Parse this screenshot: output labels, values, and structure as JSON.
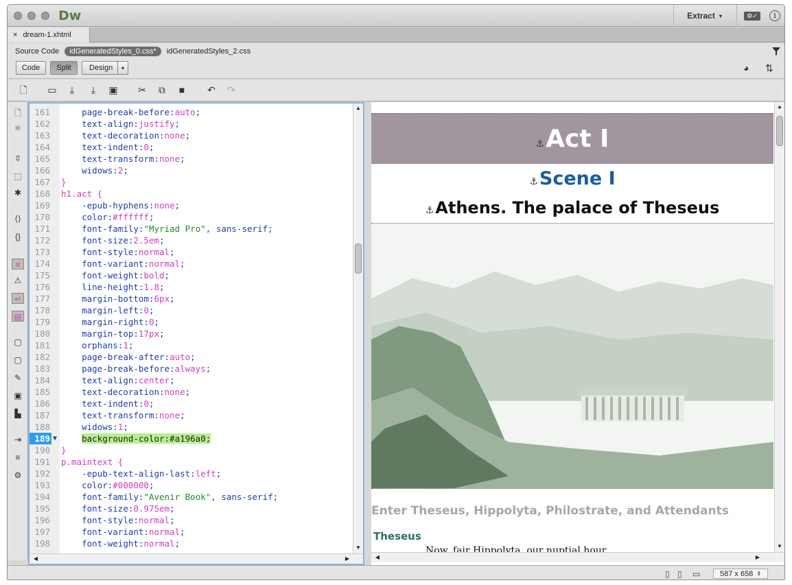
{
  "app": {
    "logo": "Dw",
    "extract": "Extract"
  },
  "doc_tab": {
    "close": "×",
    "name": "dream-1.xhtml"
  },
  "related": {
    "source": "Source Code",
    "files": [
      "idGeneratedStyles_0.css*",
      "idGeneratedStyles_2.css"
    ]
  },
  "views": {
    "code": "Code",
    "split": "Split",
    "design": "Design"
  },
  "code": {
    "lines": [
      {
        "n": "161",
        "t": [
          [
            "    ",
            ""
          ],
          [
            "page-break-before",
            "p"
          ],
          [
            ":",
            "p"
          ],
          [
            "auto",
            "v"
          ],
          [
            ";",
            "p"
          ]
        ]
      },
      {
        "n": "162",
        "t": [
          [
            "    ",
            ""
          ],
          [
            "text-align",
            "p"
          ],
          [
            ":",
            "p"
          ],
          [
            "justify",
            "v"
          ],
          [
            ";",
            "p"
          ]
        ]
      },
      {
        "n": "163",
        "t": [
          [
            "    ",
            ""
          ],
          [
            "text-decoration",
            "p"
          ],
          [
            ":",
            "p"
          ],
          [
            "none",
            "v"
          ],
          [
            ";",
            "p"
          ]
        ]
      },
      {
        "n": "164",
        "t": [
          [
            "    ",
            ""
          ],
          [
            "text-indent",
            "p"
          ],
          [
            ":",
            "p"
          ],
          [
            "0",
            "v"
          ],
          [
            ";",
            "p"
          ]
        ]
      },
      {
        "n": "165",
        "t": [
          [
            "    ",
            ""
          ],
          [
            "text-transform",
            "p"
          ],
          [
            ":",
            "p"
          ],
          [
            "none",
            "v"
          ],
          [
            ";",
            "p"
          ]
        ]
      },
      {
        "n": "166",
        "t": [
          [
            "    ",
            ""
          ],
          [
            "widows",
            "p"
          ],
          [
            ":",
            "p"
          ],
          [
            "2",
            "v"
          ],
          [
            ";",
            "p"
          ]
        ]
      },
      {
        "n": "167",
        "t": [
          [
            "}",
            "br"
          ]
        ]
      },
      {
        "n": "168",
        "t": [
          [
            "h1.act {",
            "sel"
          ]
        ]
      },
      {
        "n": "169",
        "t": [
          [
            "    ",
            ""
          ],
          [
            "-epub-hyphens",
            "p"
          ],
          [
            ":",
            "p"
          ],
          [
            "none",
            "v"
          ],
          [
            ";",
            "p"
          ]
        ]
      },
      {
        "n": "170",
        "t": [
          [
            "    ",
            ""
          ],
          [
            "color",
            "p"
          ],
          [
            ":",
            "p"
          ],
          [
            "#ffffff",
            "v"
          ],
          [
            ";",
            "p"
          ]
        ]
      },
      {
        "n": "171",
        "t": [
          [
            "    ",
            ""
          ],
          [
            "font-family",
            "p"
          ],
          [
            ":",
            "p"
          ],
          [
            "\"Myriad Pro\"",
            "s"
          ],
          [
            ", ",
            "p"
          ],
          [
            "sans-serif",
            "p"
          ],
          [
            ";",
            "p"
          ]
        ]
      },
      {
        "n": "172",
        "t": [
          [
            "    ",
            ""
          ],
          [
            "font-size",
            "p"
          ],
          [
            ":",
            "p"
          ],
          [
            "2.5em",
            "v"
          ],
          [
            ";",
            "p"
          ]
        ]
      },
      {
        "n": "173",
        "t": [
          [
            "    ",
            ""
          ],
          [
            "font-style",
            "p"
          ],
          [
            ":",
            "p"
          ],
          [
            "normal",
            "v"
          ],
          [
            ";",
            "p"
          ]
        ]
      },
      {
        "n": "174",
        "t": [
          [
            "    ",
            ""
          ],
          [
            "font-variant",
            "p"
          ],
          [
            ":",
            "p"
          ],
          [
            "normal",
            "v"
          ],
          [
            ";",
            "p"
          ]
        ]
      },
      {
        "n": "175",
        "t": [
          [
            "    ",
            ""
          ],
          [
            "font-weight",
            "p"
          ],
          [
            ":",
            "p"
          ],
          [
            "bold",
            "v"
          ],
          [
            ";",
            "p"
          ]
        ]
      },
      {
        "n": "176",
        "t": [
          [
            "    ",
            ""
          ],
          [
            "line-height",
            "p"
          ],
          [
            ":",
            "p"
          ],
          [
            "1.8",
            "v"
          ],
          [
            ";",
            "p"
          ]
        ]
      },
      {
        "n": "177",
        "t": [
          [
            "    ",
            ""
          ],
          [
            "margin-bottom",
            "p"
          ],
          [
            ":",
            "p"
          ],
          [
            "6px",
            "v"
          ],
          [
            ";",
            "p"
          ]
        ]
      },
      {
        "n": "178",
        "t": [
          [
            "    ",
            ""
          ],
          [
            "margin-left",
            "p"
          ],
          [
            ":",
            "p"
          ],
          [
            "0",
            "v"
          ],
          [
            ";",
            "p"
          ]
        ]
      },
      {
        "n": "179",
        "t": [
          [
            "    ",
            ""
          ],
          [
            "margin-right",
            "p"
          ],
          [
            ":",
            "p"
          ],
          [
            "0",
            "v"
          ],
          [
            ";",
            "p"
          ]
        ]
      },
      {
        "n": "180",
        "t": [
          [
            "    ",
            ""
          ],
          [
            "margin-top",
            "p"
          ],
          [
            ":",
            "p"
          ],
          [
            "17px",
            "v"
          ],
          [
            ";",
            "p"
          ]
        ]
      },
      {
        "n": "181",
        "t": [
          [
            "    ",
            ""
          ],
          [
            "orphans",
            "p"
          ],
          [
            ":",
            "p"
          ],
          [
            "1",
            "v"
          ],
          [
            ";",
            "p"
          ]
        ]
      },
      {
        "n": "182",
        "t": [
          [
            "    ",
            ""
          ],
          [
            "page-break-after",
            "p"
          ],
          [
            ":",
            "p"
          ],
          [
            "auto",
            "v"
          ],
          [
            ";",
            "p"
          ]
        ]
      },
      {
        "n": "183",
        "t": [
          [
            "    ",
            ""
          ],
          [
            "page-break-before",
            "p"
          ],
          [
            ":",
            "p"
          ],
          [
            "always",
            "v"
          ],
          [
            ";",
            "p"
          ]
        ]
      },
      {
        "n": "184",
        "t": [
          [
            "    ",
            ""
          ],
          [
            "text-align",
            "p"
          ],
          [
            ":",
            "p"
          ],
          [
            "center",
            "v"
          ],
          [
            ";",
            "p"
          ]
        ]
      },
      {
        "n": "185",
        "t": [
          [
            "    ",
            ""
          ],
          [
            "text-decoration",
            "p"
          ],
          [
            ":",
            "p"
          ],
          [
            "none",
            "v"
          ],
          [
            ";",
            "p"
          ]
        ]
      },
      {
        "n": "186",
        "t": [
          [
            "    ",
            ""
          ],
          [
            "text-indent",
            "p"
          ],
          [
            ":",
            "p"
          ],
          [
            "0",
            "v"
          ],
          [
            ";",
            "p"
          ]
        ]
      },
      {
        "n": "187",
        "t": [
          [
            "    ",
            ""
          ],
          [
            "text-transform",
            "p"
          ],
          [
            ":",
            "p"
          ],
          [
            "none",
            "v"
          ],
          [
            ";",
            "p"
          ]
        ]
      },
      {
        "n": "188",
        "t": [
          [
            "    ",
            ""
          ],
          [
            "widows",
            "p"
          ],
          [
            ":",
            "p"
          ],
          [
            "1",
            "v"
          ],
          [
            ";",
            "p"
          ]
        ]
      },
      {
        "n": "189",
        "cur": true,
        "t": [
          [
            "    ",
            ""
          ],
          [
            "background-color:#a196a0;",
            "hl"
          ]
        ]
      },
      {
        "n": "190",
        "t": [
          [
            "}",
            "br"
          ]
        ]
      },
      {
        "n": "191",
        "t": [
          [
            "p.maintext {",
            "sel"
          ]
        ]
      },
      {
        "n": "192",
        "t": [
          [
            "    ",
            ""
          ],
          [
            "-epub-text-align-last",
            "p"
          ],
          [
            ":",
            "p"
          ],
          [
            "left",
            "v"
          ],
          [
            ";",
            "p"
          ]
        ]
      },
      {
        "n": "193",
        "t": [
          [
            "    ",
            ""
          ],
          [
            "color",
            "p"
          ],
          [
            ":",
            "p"
          ],
          [
            "#000000",
            "v"
          ],
          [
            ";",
            "p"
          ]
        ]
      },
      {
        "n": "194",
        "t": [
          [
            "    ",
            ""
          ],
          [
            "font-family",
            "p"
          ],
          [
            ":",
            "p"
          ],
          [
            "\"Avenir Book\"",
            "s"
          ],
          [
            ", ",
            "p"
          ],
          [
            "sans-serif",
            "p"
          ],
          [
            ";",
            "p"
          ]
        ]
      },
      {
        "n": "195",
        "t": [
          [
            "    ",
            ""
          ],
          [
            "font-size",
            "p"
          ],
          [
            ":",
            "p"
          ],
          [
            "0.975em",
            "v"
          ],
          [
            ";",
            "p"
          ]
        ]
      },
      {
        "n": "196",
        "t": [
          [
            "    ",
            ""
          ],
          [
            "font-style",
            "p"
          ],
          [
            ":",
            "p"
          ],
          [
            "normal",
            "v"
          ],
          [
            ";",
            "p"
          ]
        ]
      },
      {
        "n": "197",
        "t": [
          [
            "    ",
            ""
          ],
          [
            "font-variant",
            "p"
          ],
          [
            ":",
            "p"
          ],
          [
            "normal",
            "v"
          ],
          [
            ";",
            "p"
          ]
        ]
      },
      {
        "n": "198",
        "t": [
          [
            "    ",
            ""
          ],
          [
            "font-weight",
            "p"
          ],
          [
            ":",
            "p"
          ],
          [
            "normal",
            "v"
          ],
          [
            ";",
            "p"
          ]
        ]
      }
    ]
  },
  "live": {
    "act": "Act I",
    "scene": "Scene I",
    "place": "Athens. The palace of Theseus",
    "enter": "Enter Theseus, Hippolyta, Philostrate, and Attendants",
    "speaker": "Theseus",
    "speech": "Now, fair Hippolyta, our nuptial hour",
    "anchor": "⚓"
  },
  "status": {
    "size": "587 x 658"
  },
  "colors": {
    "act_bg": "#a196a0",
    "scene": "#1e5c9b",
    "speaker": "#2f6e64",
    "enter": "#aba4aa"
  }
}
